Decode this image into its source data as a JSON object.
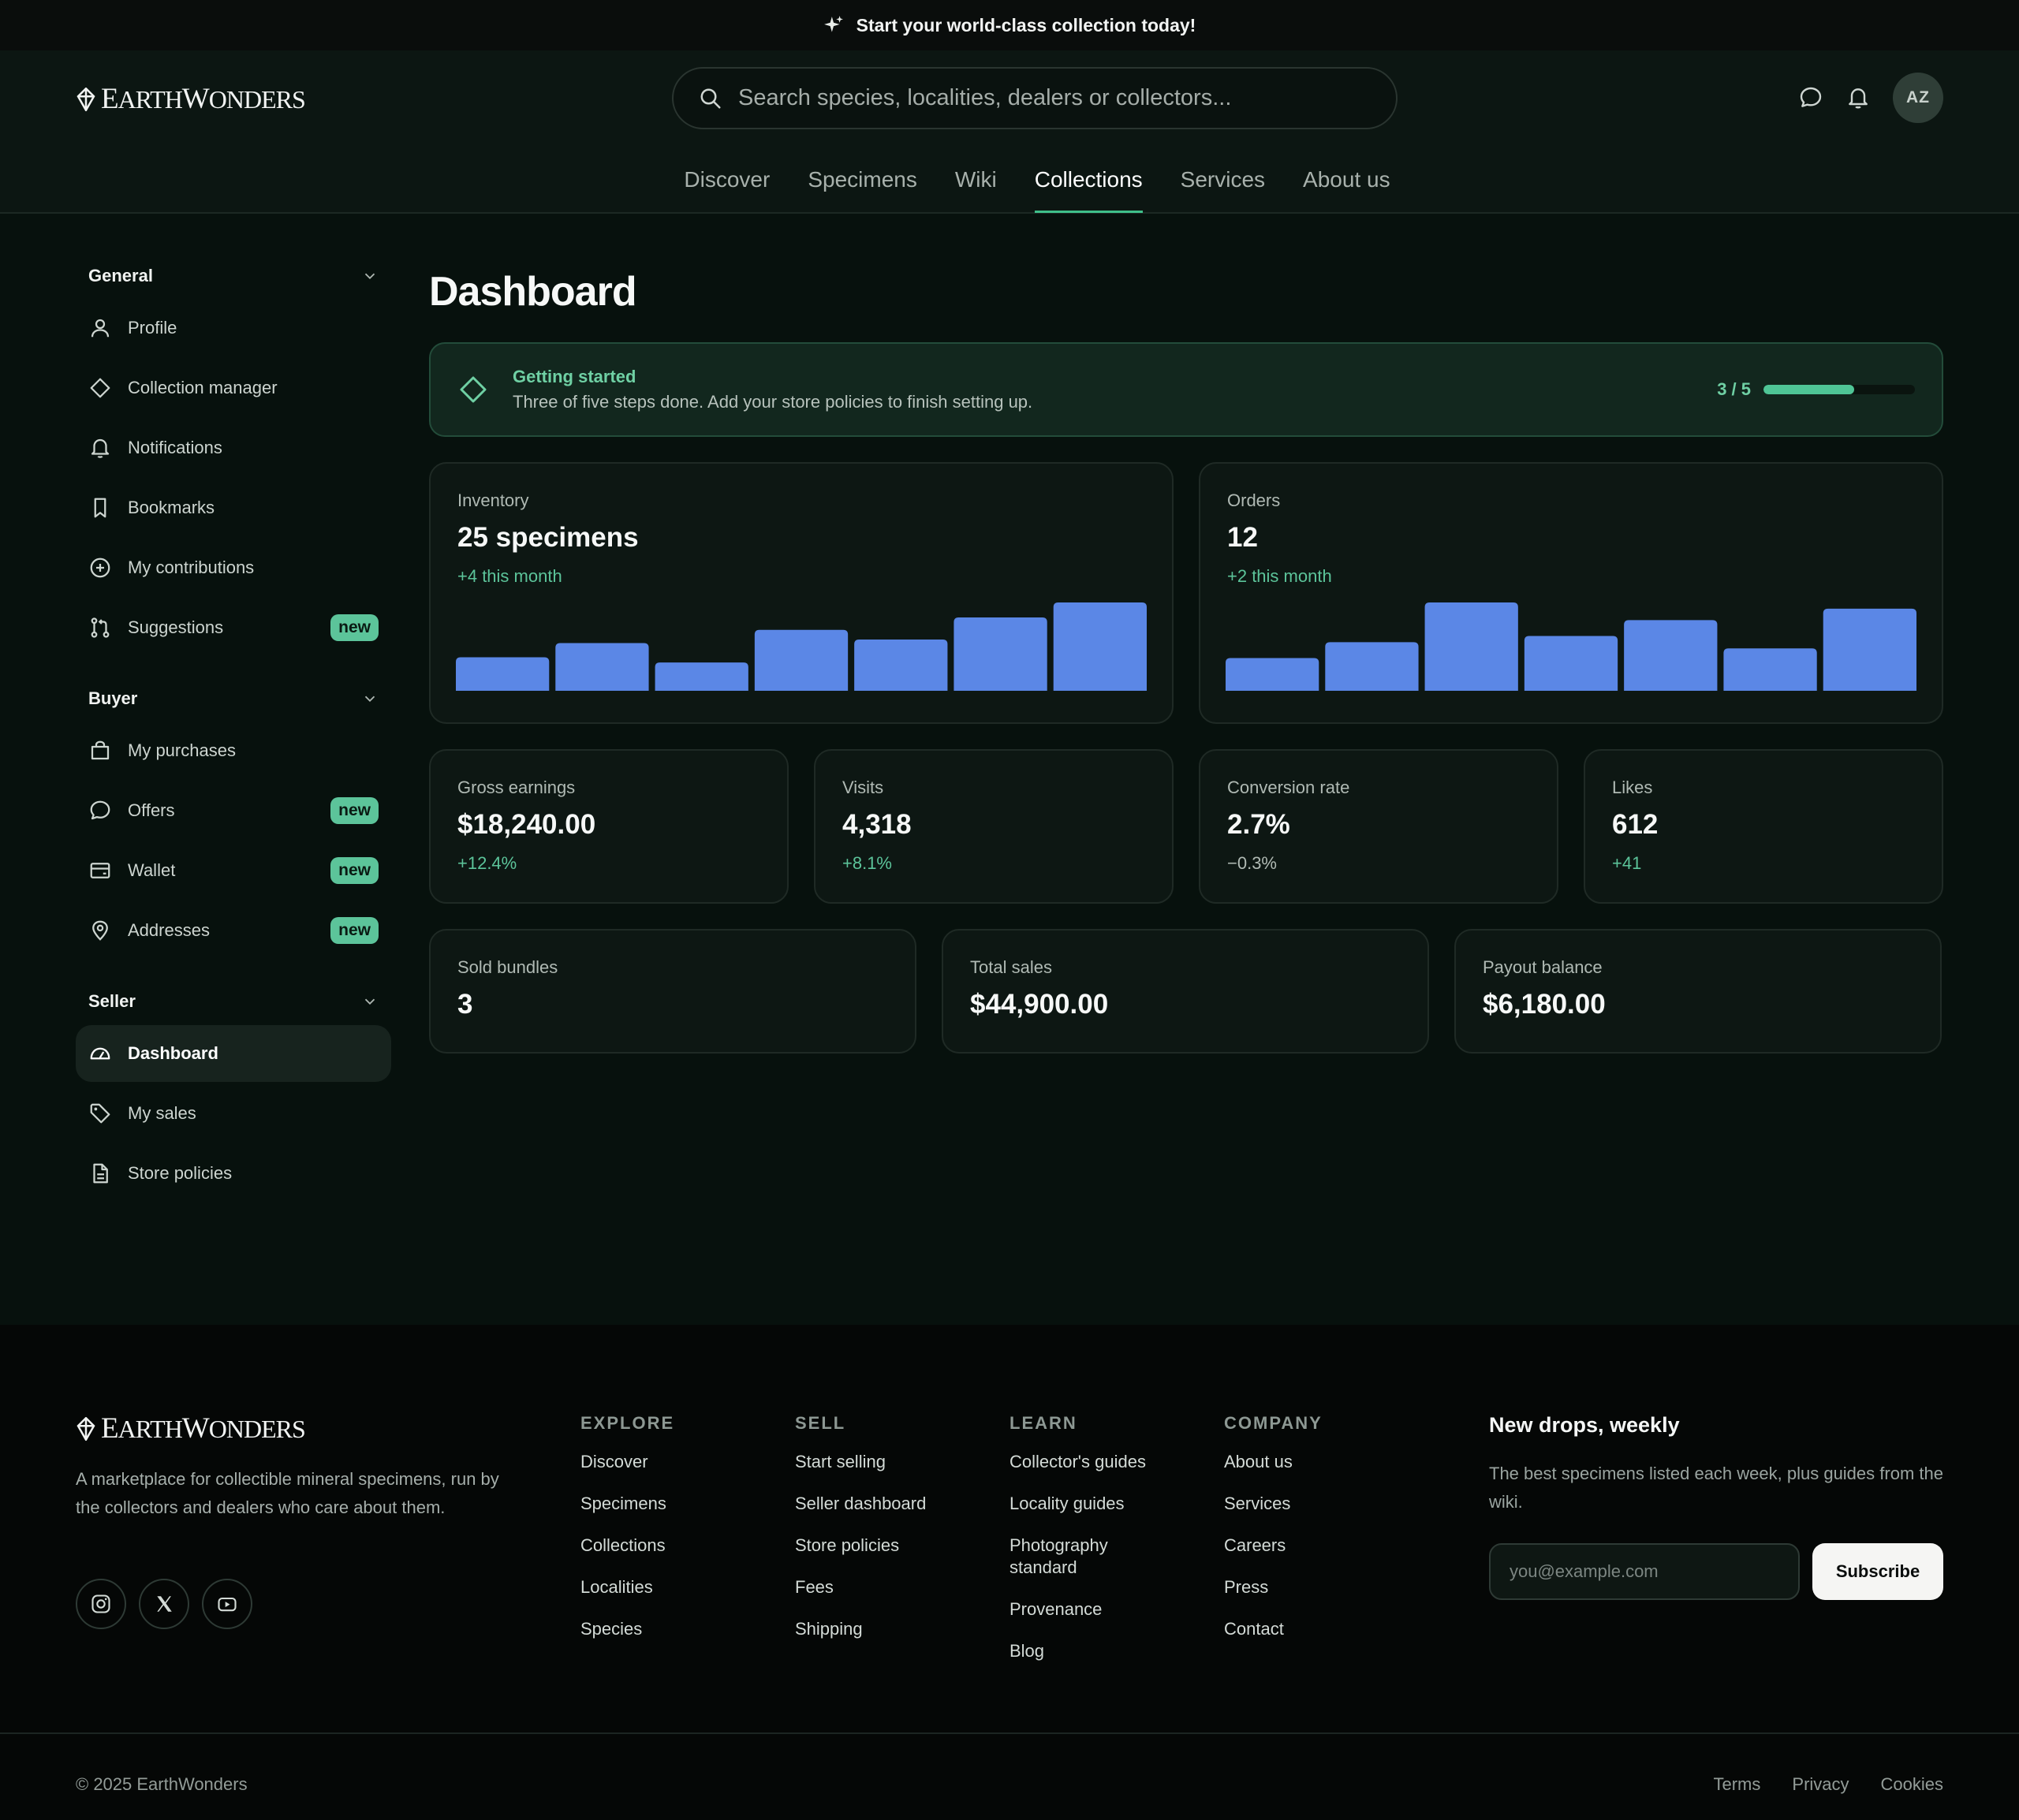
{
  "banner": {
    "icon": "sparkle-icon",
    "text": "Start your world-class collection today!"
  },
  "brand": {
    "initial1": "E",
    "rest1": "ARTH",
    "initial2": "W",
    "rest2": "ONDERS"
  },
  "search": {
    "placeholder": "Search species, localities, dealers or collectors..."
  },
  "header_icons": [
    "chat-icon",
    "bell-icon"
  ],
  "user": {
    "initials": "AZ"
  },
  "nav": {
    "items": [
      "Discover",
      "Specimens",
      "Wiki",
      "Collections",
      "Services",
      "About us"
    ],
    "active": "Collections"
  },
  "sidebar": {
    "general": {
      "title": "General",
      "items": [
        {
          "label": "Profile",
          "icon": "user-icon"
        },
        {
          "label": "Collection manager",
          "icon": "diamond-icon"
        },
        {
          "label": "Notifications",
          "icon": "bell-icon"
        },
        {
          "label": "Bookmarks",
          "icon": "bookmark-icon"
        },
        {
          "label": "My contributions",
          "icon": "plus-circle-icon"
        },
        {
          "label": "Suggestions",
          "icon": "git-pull-icon",
          "badge": "new"
        }
      ]
    },
    "buyer": {
      "title": "Buyer",
      "items": [
        {
          "label": "My purchases",
          "icon": "bag-icon"
        },
        {
          "label": "Offers",
          "icon": "chat-icon",
          "badge": "new"
        },
        {
          "label": "Wallet",
          "icon": "wallet-icon",
          "badge": "new"
        },
        {
          "label": "Addresses",
          "icon": "pin-icon",
          "badge": "new"
        }
      ]
    },
    "seller": {
      "title": "Seller",
      "items": [
        {
          "label": "Dashboard",
          "icon": "gauge-icon",
          "active": true
        },
        {
          "label": "My sales",
          "icon": "tag-icon"
        },
        {
          "label": "Store policies",
          "icon": "file-icon"
        }
      ]
    }
  },
  "main": {
    "title": "Dashboard",
    "getting_started": {
      "title": "Getting started",
      "text": "Three of five steps done. Add your store policies to finish setting up.",
      "progress_label": "3 / 5",
      "progress_fraction": 0.6
    },
    "inventory": {
      "label": "Inventory",
      "value": "25 specimens",
      "delta": "+4 this month",
      "bars": [
        0.38,
        0.54,
        0.32,
        0.69,
        0.58,
        0.83,
        1.0
      ],
      "bar_color": "#5b87e6"
    },
    "orders": {
      "label": "Orders",
      "value": "12",
      "delta": "+2 this month",
      "bars": [
        0.37,
        0.55,
        1.0,
        0.62,
        0.8,
        0.48,
        0.93
      ],
      "bar_color": "#5b87e6"
    },
    "stats": [
      {
        "label": "Gross earnings",
        "value": "$18,240.00",
        "delta": "+12.4%",
        "positive": true
      },
      {
        "label": "Visits",
        "value": "4,318",
        "delta": "+8.1%",
        "positive": true
      },
      {
        "label": "Conversion rate",
        "value": "2.7%",
        "delta": "−0.3%",
        "positive": false
      },
      {
        "label": "Likes",
        "value": "612",
        "delta": "+41",
        "positive": true
      }
    ],
    "totals": [
      {
        "label": "Sold bundles",
        "value": "3"
      },
      {
        "label": "Total sales",
        "value": "$44,900.00"
      },
      {
        "label": "Payout balance",
        "value": "$6,180.00"
      }
    ]
  },
  "footer": {
    "description": "A marketplace for collectible mineral specimens, run by the collectors and dealers who care about them.",
    "social": [
      "instagram-icon",
      "x-icon",
      "youtube-icon"
    ],
    "columns": [
      {
        "title": "EXPLORE",
        "links": [
          "Discover",
          "Specimens",
          "Collections",
          "Localities",
          "Species"
        ]
      },
      {
        "title": "SELL",
        "links": [
          "Start selling",
          "Seller dashboard",
          "Store policies",
          "Fees",
          "Shipping"
        ]
      },
      {
        "title": "LEARN",
        "links": [
          "Collector's guides",
          "Locality guides",
          "Photography standard",
          "Provenance",
          "Blog"
        ]
      },
      {
        "title": "COMPANY",
        "links": [
          "About us",
          "Services",
          "Careers",
          "Press",
          "Contact"
        ]
      }
    ],
    "newsletter": {
      "title": "New drops, weekly",
      "text": "The best specimens listed each week, plus guides from the wiki.",
      "placeholder": "you@example.com",
      "button": "Subscribe"
    },
    "copyright": "© 2025 EarthWonders",
    "legal": [
      "Terms",
      "Privacy",
      "Cookies"
    ]
  }
}
